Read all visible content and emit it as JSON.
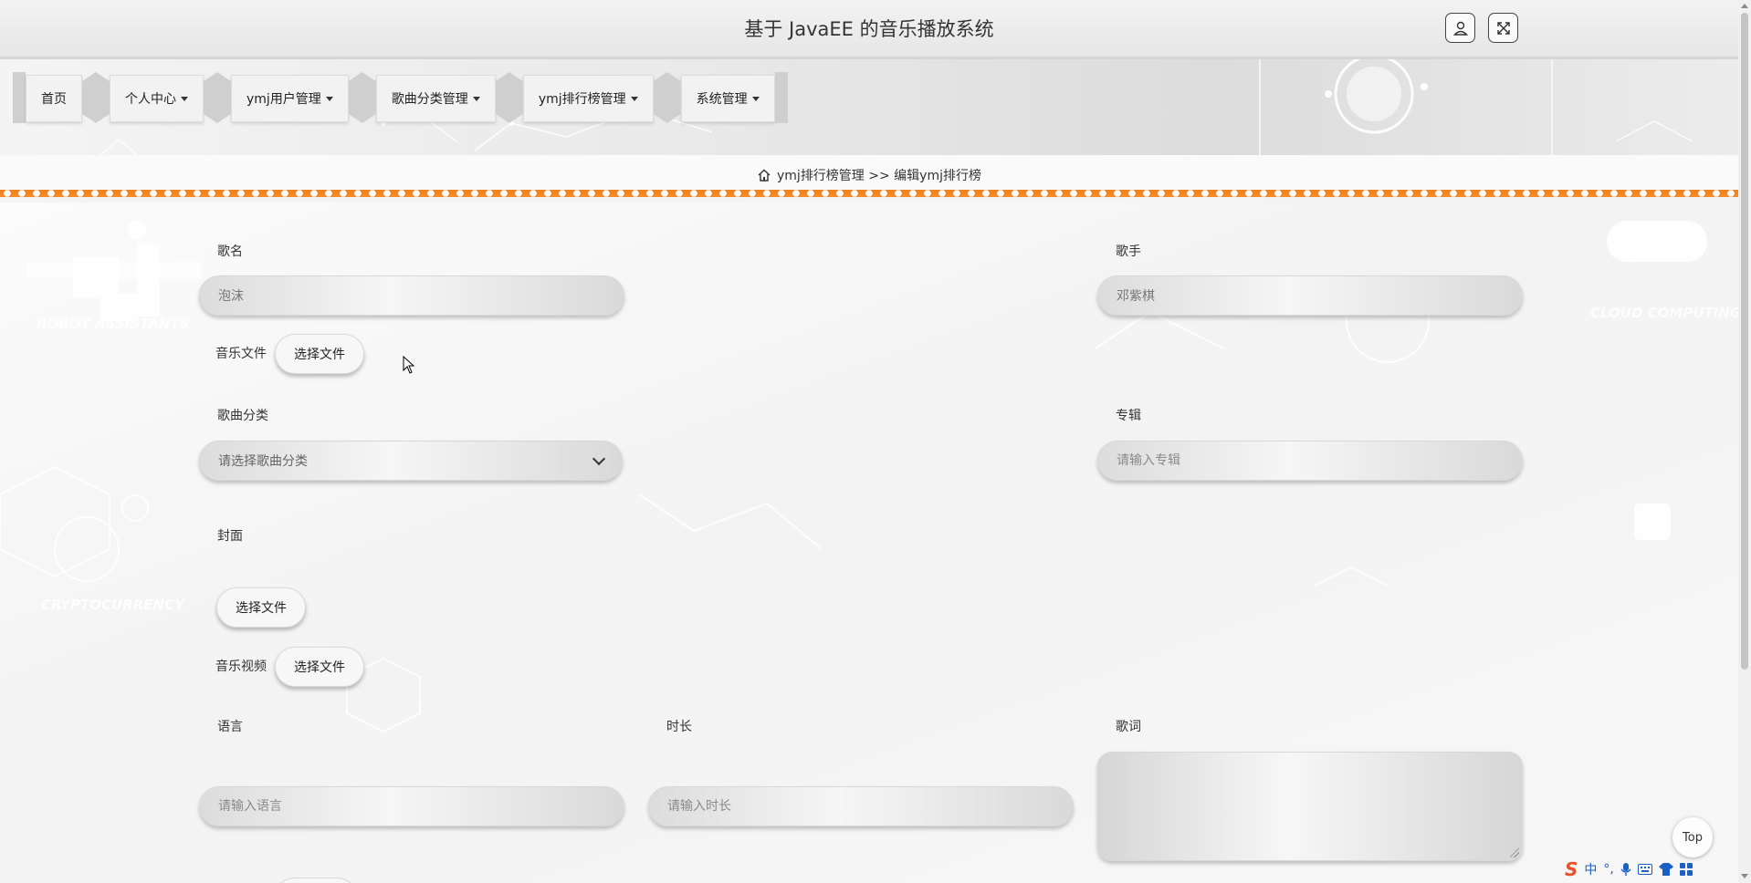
{
  "header": {
    "title": "基于 JavaEE 的音乐播放系统",
    "user_icon": "user-icon",
    "fullscreen_icon": "fullscreen-icon"
  },
  "nav": {
    "items": [
      {
        "label": "首页",
        "has_dropdown": false
      },
      {
        "label": "个人中心",
        "has_dropdown": true
      },
      {
        "label": "ymj用户管理",
        "has_dropdown": true
      },
      {
        "label": "歌曲分类管理",
        "has_dropdown": true
      },
      {
        "label": "ymj排行榜管理",
        "has_dropdown": true
      },
      {
        "label": "系统管理",
        "has_dropdown": true
      }
    ]
  },
  "breadcrumb": {
    "icon": "home-icon",
    "text": "ymj排行榜管理 >> 编辑ymj排行榜"
  },
  "form": {
    "song_name": {
      "label": "歌名",
      "value": "泡沫"
    },
    "singer": {
      "label": "歌手",
      "value": "邓紫棋"
    },
    "music_file": {
      "label": "音乐文件",
      "button": "选择文件"
    },
    "category": {
      "label": "歌曲分类",
      "selected": "请选择歌曲分类"
    },
    "album": {
      "label": "专辑",
      "placeholder": "请输入专辑"
    },
    "cover": {
      "label": "封面",
      "button": "选择文件"
    },
    "music_video": {
      "label": "音乐视频",
      "button": "选择文件"
    },
    "language": {
      "label": "语言",
      "placeholder": "请输入语言"
    },
    "duration": {
      "label": "时长",
      "placeholder": "请输入时长"
    },
    "lyrics": {
      "label": "歌词",
      "value": ""
    }
  },
  "top_button": {
    "label": "Top"
  },
  "ime": {
    "lang": "中",
    "icons": [
      "sogou-icon",
      "punctuation-icon",
      "mic-icon",
      "keyboard-icon",
      "skin-icon",
      "grid-icon"
    ]
  },
  "colors": {
    "accent": "#f08020",
    "header_bg": "#e9e9e9",
    "ime_blue": "#1a5fc4"
  }
}
